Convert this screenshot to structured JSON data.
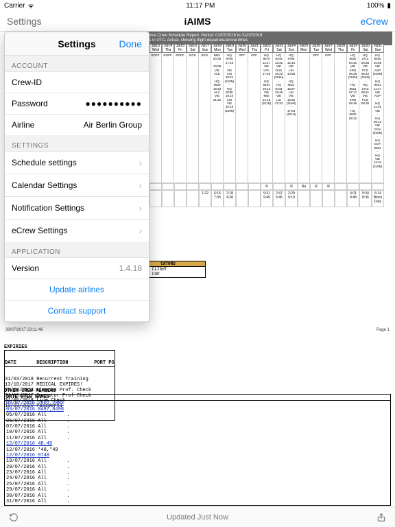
{
  "status": {
    "carrier": "Carrier",
    "wifi": "ᯤ",
    "time": "11:17 PM",
    "battery": "100%"
  },
  "nav": {
    "left": "Settings",
    "title": "iAIMS",
    "right": "eCrew"
  },
  "bg": {
    "banner1": "National Crew Schedule Report. Period: 01/07/2016 to 31/07/2016",
    "banner2": "times in UTC. Actual, showing flight departure/arrival times",
    "cells_head": [
      {
        "d": "Jul13",
        "w": "Wed"
      },
      {
        "d": "Jul14",
        "w": "Thu"
      },
      {
        "d": "Jul15",
        "w": "Fri"
      },
      {
        "d": "Jul16",
        "w": "Sat"
      },
      {
        "d": "Jul17",
        "w": "Sun"
      },
      {
        "d": "Jul18",
        "w": "Mon"
      },
      {
        "d": "Jul19",
        "w": "Tue"
      },
      {
        "d": "Jul20",
        "w": "Wed"
      },
      {
        "d": "Jul21",
        "w": "Thu"
      },
      {
        "d": "Jul22",
        "w": "Fri"
      },
      {
        "d": "Jul23",
        "w": "Sat"
      },
      {
        "d": "Jul24",
        "w": "Sun"
      },
      {
        "d": "Jul25",
        "w": "Mon"
      },
      {
        "d": "Jul26",
        "w": "Tue"
      },
      {
        "d": "Jul27",
        "w": "Wed"
      },
      {
        "d": "Jul28",
        "w": "Thu"
      },
      {
        "d": "Jul29",
        "w": "Fri"
      },
      {
        "d": "Jul30",
        "w": "Sat"
      },
      {
        "d": "Jul31",
        "w": "Sun"
      }
    ],
    "cells_body": [
      "ROFF",
      "ROFF",
      "ROFF",
      "SICK",
      "SICK",
      "BBX\n00:35\n-\n10:08\nVIE\nALE\n-\nHQ\n2629\n18:43\nALC\nVIE\n21:20",
      "HQ\n8755\n17:15\n-\nVIE\nLIN\n18:24\n(319N)\n-\nHQ\n8758\n19:10\nLIN\nVIE\n20:19\n(319N)",
      "OFF",
      "OFF",
      "HQ\n8570\n11:17\nVIE\nLPA\n17:46\n-\nHQ\n8444\n19:15\nVIE\nMIE\n21:15\n(321N)",
      "HQ\n8443\n13:31\nVIE\nDUS\n18:22\n(321N)\n-\nHQ\n8444\n19:45\nVIE\nLIS\n23:33",
      "HQ\n8756\n12:14\nVIE\nLIN\n14:58\n-\nHQ\n8021\n15:57\nLIN\nVIE\n15:52\n(319N)\n-\n17:04\n(321N)",
      "",
      "OFF",
      "OFF",
      "",
      "HQ\n8020\n04:30\nVIE\nKRN\n06:26\n(319N)\n-\nHQ\n8021\n07:17\nVIE\nKRN\n08:45\n-\nHQ\n8020\n09:22",
      "HQ\n2714\n04:35\nVIE\nFCO\n05:42\n(319N)\n-\nHQ\n2715\n08:21\nVIE\nFCO\n08:30",
      "HQ\n8020\n16:59\nVIE\nAGP\n(319N)\n-\nHQ\n8021\n11:17\nVIE\nAGP\n-\nHQ\n11:25\nVIE\n-\nHQ\n06:13\nVIE\nGOA\n(319N)\n-\nHQ\nGOA\n0834\n-\nHQ\nVIE\n12:34\n(319N)"
    ],
    "foot_labels": [
      "",
      "",
      "",
      "",
      "",
      "",
      "",
      "",
      "",
      "R",
      "",
      "R",
      "Ra",
      "R",
      "R",
      "",
      "",
      "",
      ""
    ],
    "foot_vals": [
      "",
      "",
      "",
      "",
      "1:22",
      "6:15\n7:35",
      "2:18\n4:28",
      "",
      "",
      "9:31\n9:45",
      "2:47\n5:45",
      "2:29\n0:19",
      "",
      "",
      "",
      "",
      "4:01\n9:48",
      "5:34\n8:36",
      "6:14\nBlock\nDuty"
    ]
  },
  "remarks": {
    "title": "CATORS",
    "l1": "QUESTED FLIGHT",
    "l2": "xtended FDP"
  },
  "meta": {
    "ts": "30/07/2017 23:11:46",
    "page": "Page 1"
  },
  "expiries": {
    "title": "EXPIRIES",
    "header": "DATE       DESCRIPTION         PORT PS",
    "rows": [
      "31/03/2018 Recurrent Training",
      "13/10/2017 MEDICAL EXPIRES!",
      "30/04/2018 License Prof. Check",
      "31/10/2017 Operator Prof Check",
      "31/05/2018 Line Check",
      "19/03/2020 Passport1"
    ]
  },
  "ocm": {
    "title": "OTHER CREW MEMBERS",
    "header": "DATE       RTES       NAMES",
    "rows": [
      {
        "t": "03/07/2016 2802,2803",
        "link": true
      },
      {
        "t": "03/07/2016 8497,8498",
        "link": true
      },
      {
        "t": "05/07/2016 All       .",
        "link": false
      },
      {
        "t": "06/07/2016 All       .",
        "link": false
      },
      {
        "t": "07/07/2016 All       .",
        "link": false
      },
      {
        "t": "10/07/2016 All       .",
        "link": false
      },
      {
        "t": "11/07/2016 All       .",
        "link": false
      },
      {
        "t": "12/07/2016 48,49",
        "link": true
      },
      {
        "t": "12/07/2016 *48,*49",
        "link": false
      },
      {
        "t": "12/07/2016 9748",
        "link": true
      },
      {
        "t": "19/07/2016 All       .",
        "link": false
      },
      {
        "t": "20/07/2016 All       .",
        "link": false
      },
      {
        "t": "23/07/2016 All       .",
        "link": false
      },
      {
        "t": "24/07/2016 All       .",
        "link": false
      },
      {
        "t": "25/07/2016 All       .",
        "link": false
      },
      {
        "t": "29/07/2016 All       .",
        "link": false
      },
      {
        "t": "30/07/2016 All       .",
        "link": false
      },
      {
        "t": "31/07/2016 All       .",
        "link": false
      }
    ]
  },
  "popover": {
    "title": "Settings",
    "done": "Done",
    "sec_account": "ACCOUNT",
    "crew_id_label": "Crew-ID",
    "password_label": "Password",
    "password_value": "●●●●●●●●●●",
    "airline_label": "Airline",
    "airline_value": "Air Berlin Group",
    "sec_settings": "SETTINGS",
    "row_sched": "Schedule settings",
    "row_cal": "Calendar Settings",
    "row_notif": "Notification Settings",
    "row_ecrew": "eCrew Settings",
    "sec_app": "APPLICATION",
    "version_label": "Version",
    "version_value": "1.4.18",
    "link_update": "Update airlines",
    "link_support": "Contact support"
  },
  "toolbar": {
    "status": "Updated Just Now"
  }
}
